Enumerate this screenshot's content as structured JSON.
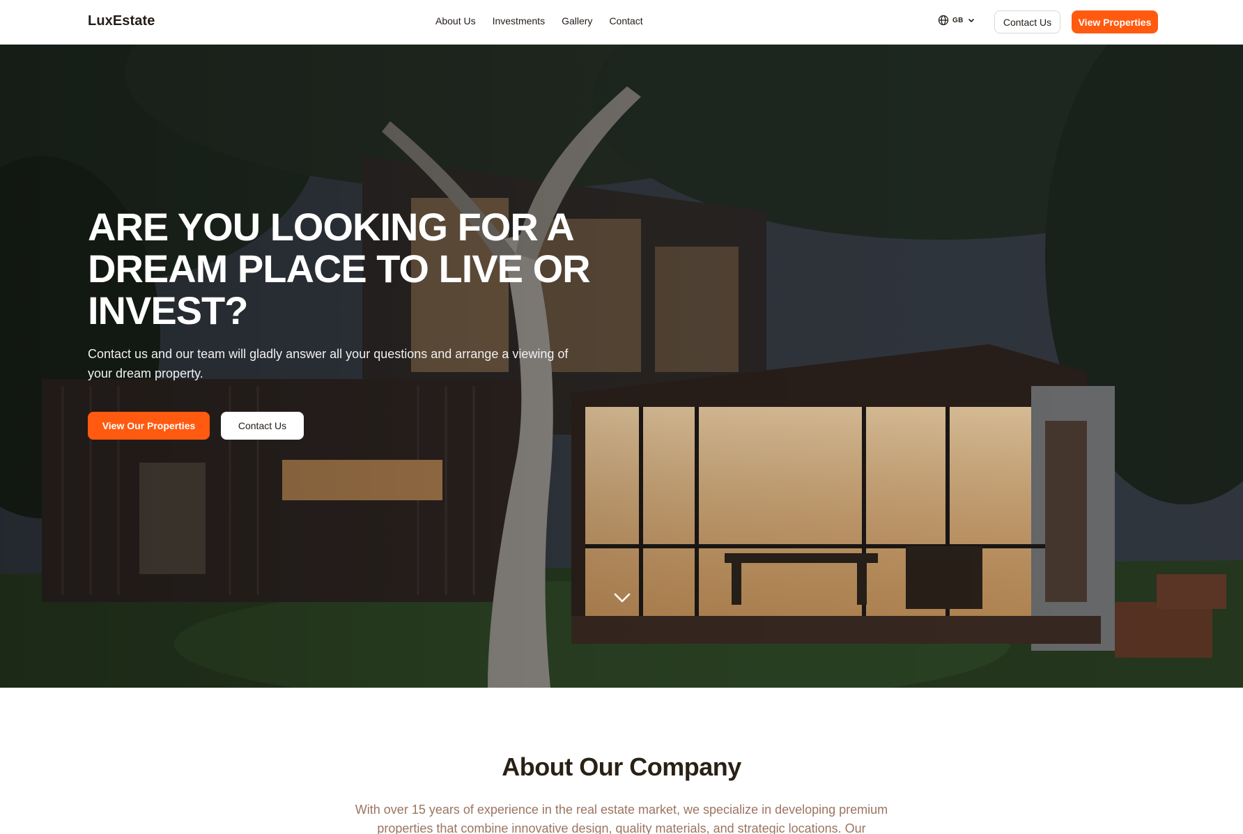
{
  "brand": {
    "logo": "LuxEstate"
  },
  "nav": {
    "links": [
      "About Us",
      "Investments",
      "Gallery",
      "Contact"
    ],
    "language": "GB",
    "contact_label": "Contact Us",
    "cta_label": "View Properties"
  },
  "hero": {
    "title": "ARE YOU LOOKING FOR A DREAM PLACE TO LIVE OR INVEST?",
    "subtitle": "Contact us and our team will gladly answer all your questions and arrange a viewing of your dream property.",
    "primary_label": "View Our Properties",
    "secondary_label": "Contact Us"
  },
  "about": {
    "title": "About Our Company",
    "text": "With over 15 years of experience in the real estate market, we specialize in developing premium properties that combine innovative design, quality materials, and strategic locations. Our"
  },
  "colors": {
    "accent": "#ff5a10",
    "about_text": "#9c7461",
    "heading": "#2a2116"
  },
  "icons": {
    "language": "globe-icon",
    "dropdown": "chevron-down-icon",
    "scroll": "scroll-down-icon"
  }
}
